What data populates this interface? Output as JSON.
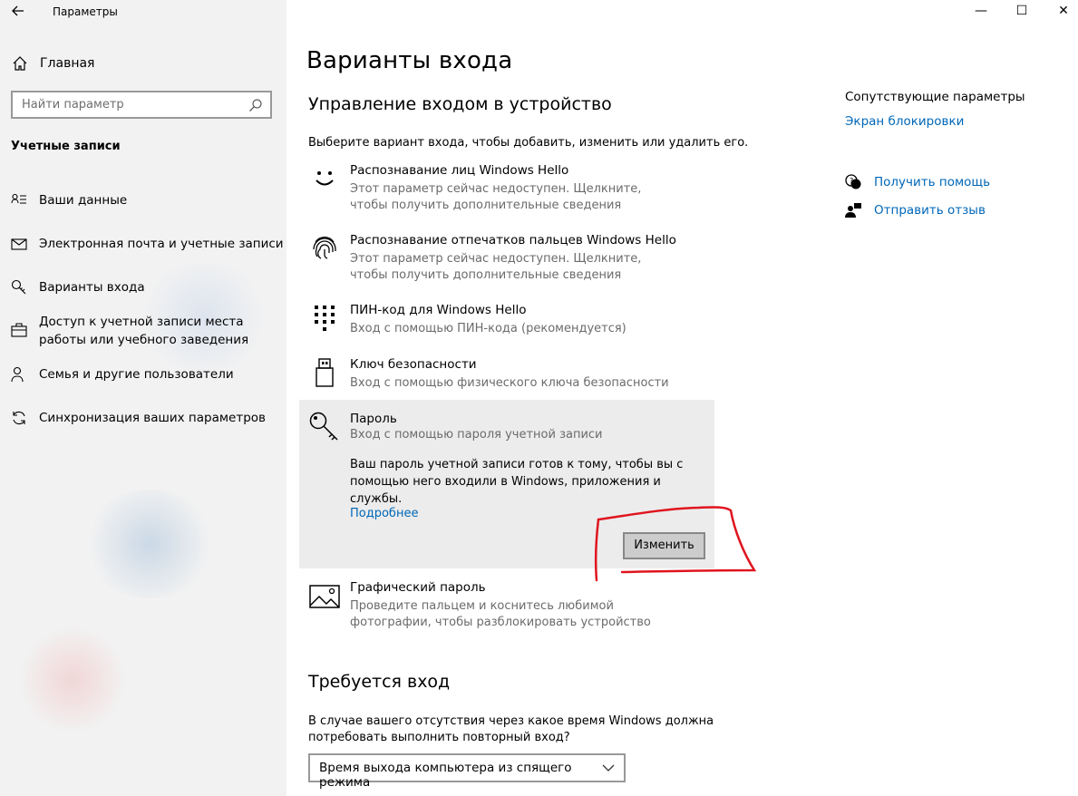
{
  "window": {
    "title": "Параметры",
    "back_icon": "back-arrow-icon",
    "minimize": "—",
    "maximize": "☐",
    "close": "✕"
  },
  "sidebar": {
    "home_label": "Главная",
    "search_placeholder": "Найти параметр",
    "section_title": "Учетные записи",
    "items": [
      {
        "label": "Ваши данные",
        "icon": "person-card-icon"
      },
      {
        "label": "Электронная почта и учетные записи",
        "icon": "mail-icon"
      },
      {
        "label": "Варианты входа",
        "icon": "key-icon"
      },
      {
        "label": "Доступ к учетной записи места работы или учебного заведения",
        "icon": "briefcase-icon"
      },
      {
        "label": "Семья и другие пользователи",
        "icon": "person-add-icon"
      },
      {
        "label": "Синхронизация ваших параметров",
        "icon": "sync-icon"
      }
    ]
  },
  "main": {
    "page_title": "Варианты входа",
    "subtitle": "Управление входом в устройство",
    "intro": "Выберите вариант входа, чтобы добавить, изменить или удалить его.",
    "options": [
      {
        "title": "Распознавание лиц Windows Hello",
        "desc": "Этот параметр сейчас недоступен. Щелкните, чтобы получить дополнительные сведения",
        "icon": "face-icon"
      },
      {
        "title": "Распознавание отпечатков пальцев Windows Hello",
        "desc": "Этот параметр сейчас недоступен. Щелкните, чтобы получить дополнительные сведения",
        "icon": "fingerprint-icon"
      },
      {
        "title": "ПИН-код для Windows Hello",
        "desc": "Вход с помощью ПИН-кода (рекомендуется)",
        "icon": "pin-keypad-icon"
      },
      {
        "title": "Ключ безопасности",
        "desc": "Вход с помощью физического ключа безопасности",
        "icon": "usb-key-icon"
      }
    ],
    "password": {
      "title": "Пароль",
      "desc": "Вход с помощью пароля учетной записи",
      "long_desc": "Ваш пароль учетной записи готов к тому, чтобы вы с помощью него входили в Windows, приложения и службы.",
      "more_link": "Подробнее",
      "change_button": "Изменить",
      "icon": "key-icon"
    },
    "picture_password": {
      "title": "Графический пароль",
      "desc": "Проведите пальцем и коснитесь любимой фотографии, чтобы разблокировать устройство",
      "icon": "picture-icon"
    },
    "require_signin": {
      "title": "Требуется вход",
      "desc": "В случае вашего отсутствия через какое время Windows должна потребовать выполнить повторный вход?",
      "dropdown_value": "Время выхода компьютера из спящего режима"
    }
  },
  "related": {
    "title": "Сопутствующие параметры",
    "lock_screen_link": "Экран блокировки",
    "get_help": "Получить помощь",
    "feedback": "Отправить отзыв"
  },
  "colors": {
    "accent_link": "#0067b8",
    "annotation_red": "#e0141e",
    "sidebar_bg": "#f2f2f2",
    "panel_bg": "#ececec"
  }
}
